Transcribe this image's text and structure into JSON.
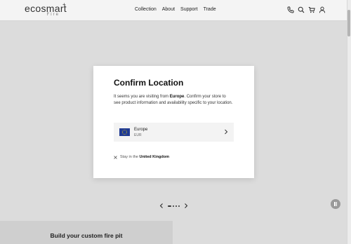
{
  "header": {
    "logo_main": "ecosmart",
    "logo_plus": "+",
    "logo_sub": "Fire",
    "nav": [
      "Collection",
      "About",
      "Support",
      "Trade"
    ],
    "icons": [
      "phone-icon",
      "search-icon",
      "cart-icon",
      "user-icon"
    ]
  },
  "modal": {
    "title": "Confirm Location",
    "desc_prefix": "It seems you are visiting from ",
    "desc_region": "Europe",
    "desc_suffix": ". Confirm your store to see product information and availability specific to your location.",
    "region": {
      "name": "Europe",
      "currency": "EUR"
    },
    "stay_prefix": "Stay in the ",
    "stay_country": "United Kingdom"
  },
  "carousel": {
    "dots": 4,
    "active_index": 0
  },
  "promo": {
    "title": "Build your custom fire pit"
  },
  "colors": {
    "page_bg": "#dcdcdc",
    "header_bg": "#f4f4f4",
    "modal_bg": "#ffffff",
    "eu_blue": "#1f3a93",
    "eu_star": "#f5d300"
  }
}
